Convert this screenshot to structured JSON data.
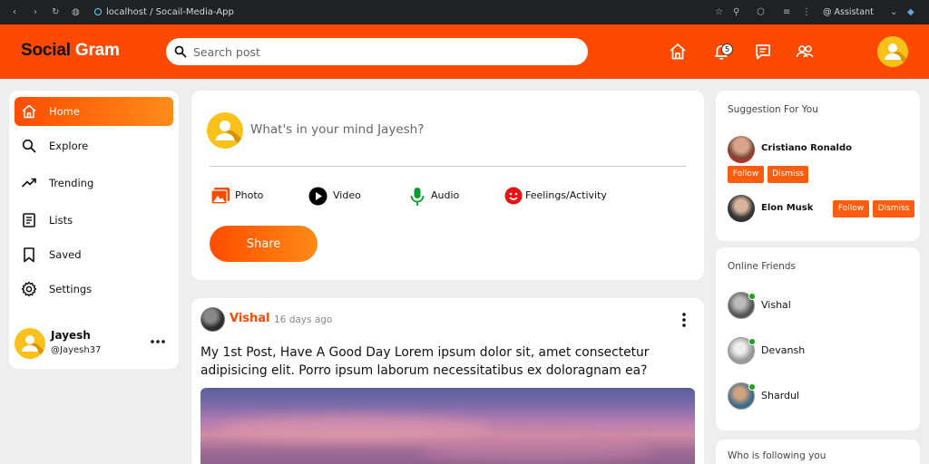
{
  "browser": {
    "url": "localhost / Socail-Media-App",
    "assistant_label": "Assistant"
  },
  "header": {
    "brand_first": "Social",
    "brand_second": "Gram",
    "search_placeholder": "Search post",
    "notification_count": "5",
    "accent_color": "#fd4a00"
  },
  "sidebar": {
    "menu": [
      {
        "label": "Home",
        "icon": "home-icon",
        "active": true
      },
      {
        "label": "Explore",
        "icon": "search-icon",
        "active": false
      },
      {
        "label": "Trending",
        "icon": "trending-icon",
        "active": false
      },
      {
        "label": "Lists",
        "icon": "list-icon",
        "active": false
      },
      {
        "label": "Saved",
        "icon": "bookmark-icon",
        "active": false
      },
      {
        "label": "Settings",
        "icon": "gear-icon",
        "active": false
      }
    ],
    "profile": {
      "name": "Jayesh",
      "handle": "@Jayesh37"
    }
  },
  "composer": {
    "placeholder": "What's in your mind Jayesh?",
    "actions": [
      {
        "label": "Photo",
        "icon": "photo-icon",
        "color": "#fd4a00"
      },
      {
        "label": "Video",
        "icon": "play-icon",
        "color": "#000000"
      },
      {
        "label": "Audio",
        "icon": "microphone-icon",
        "color": "#0a9a2e"
      },
      {
        "label": "Feelings/Activity",
        "icon": "smiley-icon",
        "color": "#ee1111"
      }
    ],
    "share_label": "Share"
  },
  "post": {
    "user": "Vishal",
    "time": "16 days ago",
    "text": "My 1st Post, Have A Good Day Lorem ipsum dolor sit, amet consectetur adipisicing elit. Porro ipsum laborum necessitatibus ex doloragnam ea?"
  },
  "suggestions": {
    "title": "Suggestion For You",
    "people": [
      {
        "name": "Cristiano Ronaldo",
        "follow": "Follow",
        "dismiss": "Dismiss"
      },
      {
        "name": "Elon Musk",
        "follow": "Follow",
        "dismiss": "Dismiss"
      }
    ]
  },
  "online_friends": {
    "title": "Online Friends",
    "friends": [
      {
        "name": "Vishal",
        "online_color": "#17a21b"
      },
      {
        "name": "Devansh",
        "online_color": "#17a21b"
      },
      {
        "name": "Shardul",
        "online_color": "#17a21b"
      }
    ]
  },
  "following": {
    "title": "Who is following you"
  }
}
